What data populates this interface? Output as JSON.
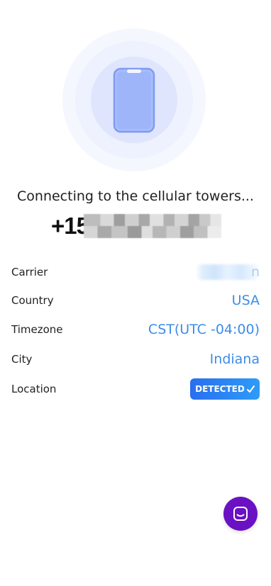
{
  "status": {
    "message": "Connecting to the cellular towers..."
  },
  "phone": {
    "number_visible": "+15"
  },
  "details": {
    "carrier": {
      "label": "Carrier",
      "value_visible": "n"
    },
    "country": {
      "label": "Country",
      "value": "USA"
    },
    "timezone": {
      "label": "Timezone",
      "value": "CST(UTC -04:00)"
    },
    "city": {
      "label": "City",
      "value": "Indiana"
    },
    "location": {
      "label": "Location",
      "badge": "DETECTED",
      "badge_icon": "check-icon"
    }
  },
  "chat": {
    "icon": "chat-icon"
  },
  "colors": {
    "accent": "#3d8ce8",
    "badge_start": "#2a6ef0",
    "badge_end": "#2d9cf6",
    "chat_button": "#6a11c4",
    "phone_fill": "#a9bdfb"
  }
}
